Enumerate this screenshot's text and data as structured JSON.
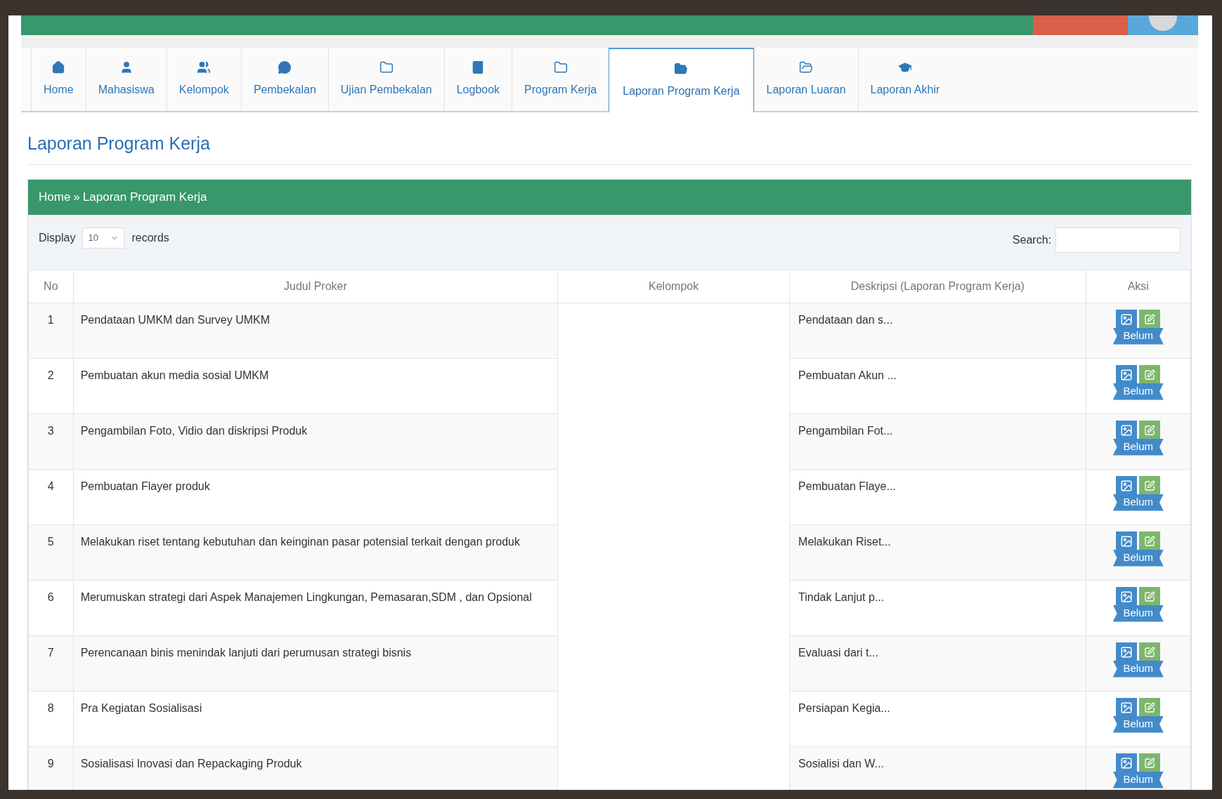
{
  "tabs": [
    {
      "label": "Home",
      "selected": false
    },
    {
      "label": "Mahasiswa",
      "selected": false
    },
    {
      "label": "Kelompok",
      "selected": false
    },
    {
      "label": "Pembekalan",
      "selected": false
    },
    {
      "label": "Ujian Pembekalan",
      "selected": false
    },
    {
      "label": "Logbook",
      "selected": false
    },
    {
      "label": "Program Kerja",
      "selected": false
    },
    {
      "label": "Laporan Program Kerja",
      "selected": true
    },
    {
      "label": "Laporan Luaran",
      "selected": false
    },
    {
      "label": "Laporan Akhir",
      "selected": false
    }
  ],
  "page_title": "Laporan Program Kerja",
  "breadcrumb": {
    "home": "Home",
    "separator": "»",
    "current": "Laporan Program Kerja"
  },
  "length_control": {
    "label": "Display",
    "value": "10",
    "suffix": "records"
  },
  "search": {
    "label": "Search:"
  },
  "table": {
    "columns": [
      "No",
      "Judul Proker",
      "Kelompok",
      "Deskripsi (Laporan Program Kerja)",
      "Aksi"
    ],
    "rows": [
      {
        "no": "1",
        "judul": "Pendataan UMKM dan Survey UMKM",
        "deskripsi": "Pendataan dan s...",
        "status": "Belum"
      },
      {
        "no": "2",
        "judul": "Pembuatan akun media sosial UMKM",
        "deskripsi": "Pembuatan Akun ...",
        "status": "Belum"
      },
      {
        "no": "3",
        "judul": "Pengambilan Foto, Vidio dan diskripsi Produk",
        "deskripsi": "Pengambilan Fot...",
        "status": "Belum"
      },
      {
        "no": "4",
        "judul": "Pembuatan Flayer produk",
        "deskripsi": "Pembuatan Flaye...",
        "status": "Belum"
      },
      {
        "no": "5",
        "judul": "Melakukan riset tentang kebutuhan dan keinginan pasar potensial terkait dengan produk",
        "deskripsi": "Melakukan Riset...",
        "status": "Belum"
      },
      {
        "no": "6",
        "judul": "Merumuskan strategi dari Aspek Manajemen Lingkungan, Pemasaran,SDM , dan Opsional",
        "deskripsi": "Tindak Lanjut p...",
        "status": "Belum"
      },
      {
        "no": "7",
        "judul": "Perencanaan binis menindak lanjuti dari perumusan strategi bisnis",
        "deskripsi": "Evaluasi dari t...",
        "status": "Belum"
      },
      {
        "no": "8",
        "judul": "Pra Kegiatan Sosialisasi",
        "deskripsi": "Persiapan Kegia...",
        "status": "Belum"
      },
      {
        "no": "9",
        "judul": "Sosialisasi Inovasi dan Repackaging Produk",
        "deskripsi": "Sosialisi dan W...",
        "status": "Belum"
      }
    ]
  }
}
